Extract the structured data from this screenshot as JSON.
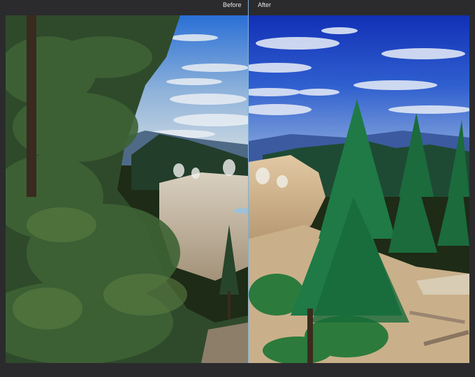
{
  "compare": {
    "before_label": "Before",
    "after_label": "After"
  },
  "theme": {
    "background": "#2b2b2d",
    "label_color": "#e6e6e6",
    "divider_color": "#7fb2d8"
  },
  "photo": {
    "before_sky_top": "#2b6fd4",
    "before_sky_horizon": "#c6d7e6",
    "after_sky_top": "#1436b8",
    "after_sky_horizon": "#6f9ad8",
    "before_tree": "#2f4d2a",
    "after_tree": "#1b6d3a"
  }
}
